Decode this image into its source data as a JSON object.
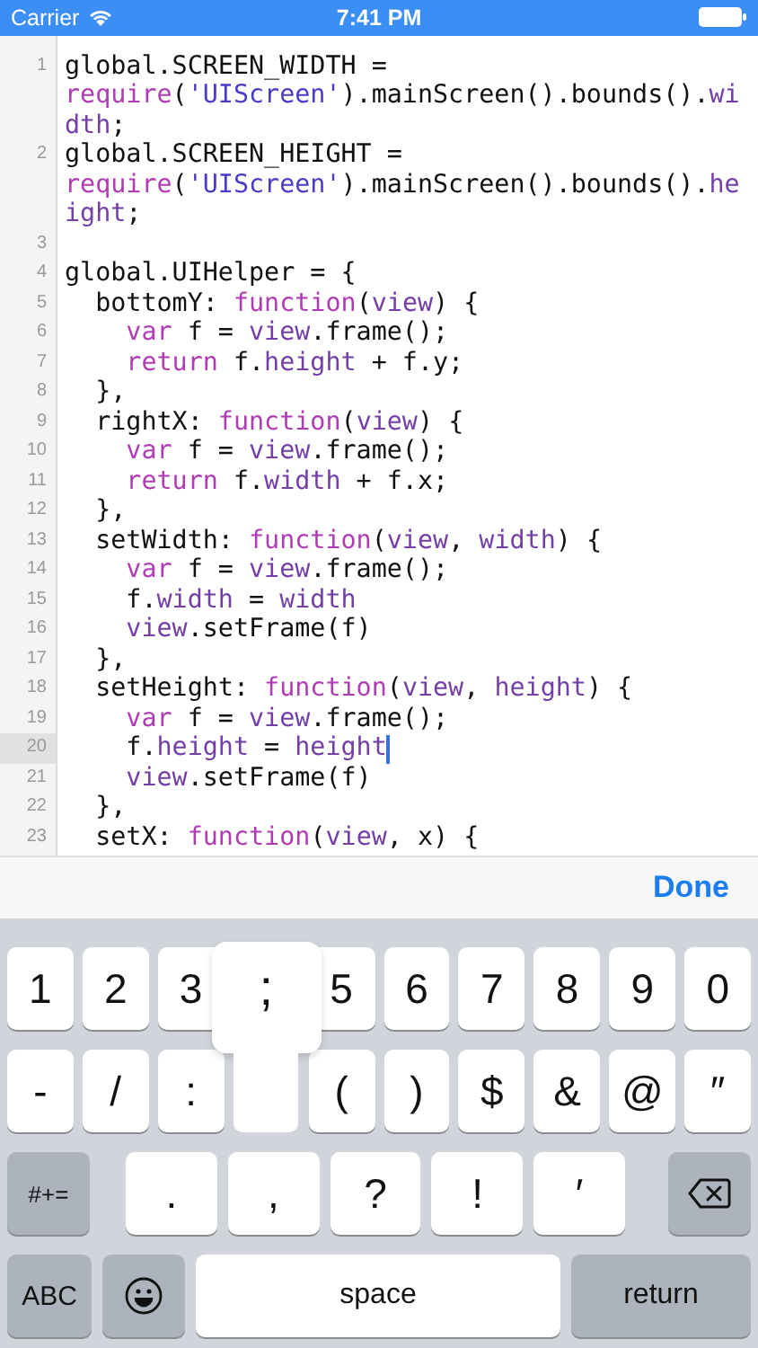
{
  "status_bar": {
    "carrier": "Carrier",
    "time": "7:41 PM"
  },
  "editor": {
    "lines": [
      {
        "number": "1",
        "current": false,
        "rows": [
          {
            "segments": [
              {
                "kind": "plain",
                "text": "global.SCREEN_WIDTH ="
              }
            ]
          },
          {
            "segments": [
              {
                "kind": "keyword",
                "text": "require"
              },
              {
                "kind": "plain",
                "text": "("
              },
              {
                "kind": "string",
                "text": "'UIScreen'"
              },
              {
                "kind": "plain",
                "text": ").mainScreen().bounds()."
              },
              {
                "kind": "ident",
                "text": "wi"
              }
            ]
          },
          {
            "segments": [
              {
                "kind": "ident",
                "text": "dth"
              },
              {
                "kind": "plain",
                "text": ";"
              }
            ]
          }
        ]
      },
      {
        "number": "2",
        "current": false,
        "rows": [
          {
            "segments": [
              {
                "kind": "plain",
                "text": "global.SCREEN_HEIGHT ="
              }
            ]
          },
          {
            "segments": [
              {
                "kind": "keyword",
                "text": "require"
              },
              {
                "kind": "plain",
                "text": "("
              },
              {
                "kind": "string",
                "text": "'UIScreen'"
              },
              {
                "kind": "plain",
                "text": ").mainScreen().bounds()."
              },
              {
                "kind": "ident",
                "text": "he"
              }
            ]
          },
          {
            "segments": [
              {
                "kind": "ident",
                "text": "ight"
              },
              {
                "kind": "plain",
                "text": ";"
              }
            ]
          }
        ]
      },
      {
        "number": "3",
        "current": false
      },
      {
        "number": "4",
        "current": false,
        "rows": [
          {
            "segments": [
              {
                "kind": "plain",
                "text": "global.UIHelper = {"
              }
            ]
          }
        ]
      },
      {
        "number": "5",
        "current": false,
        "rows": [
          {
            "segments": [
              {
                "kind": "plain",
                "text": "  bottomY: "
              },
              {
                "kind": "keyword",
                "text": "function"
              },
              {
                "kind": "plain",
                "text": "("
              },
              {
                "kind": "ident",
                "text": "view"
              },
              {
                "kind": "plain",
                "text": ") {"
              }
            ]
          }
        ]
      },
      {
        "number": "6",
        "current": false,
        "rows": [
          {
            "segments": [
              {
                "kind": "keyword",
                "text": "    var"
              },
              {
                "kind": "plain",
                "text": " f = "
              },
              {
                "kind": "ident",
                "text": "view"
              },
              {
                "kind": "plain",
                "text": ".frame();"
              }
            ]
          }
        ]
      },
      {
        "number": "7",
        "current": false,
        "rows": [
          {
            "segments": [
              {
                "kind": "keyword",
                "text": "    return"
              },
              {
                "kind": "plain",
                "text": " f."
              },
              {
                "kind": "ident",
                "text": "height"
              },
              {
                "kind": "plain",
                "text": " + f.y;"
              }
            ]
          }
        ]
      },
      {
        "number": "8",
        "current": false,
        "rows": [
          {
            "segments": [
              {
                "kind": "plain",
                "text": "  },"
              }
            ]
          }
        ]
      },
      {
        "number": "9",
        "current": false,
        "rows": [
          {
            "segments": [
              {
                "kind": "plain",
                "text": "  rightX: "
              },
              {
                "kind": "keyword",
                "text": "function"
              },
              {
                "kind": "plain",
                "text": "("
              },
              {
                "kind": "ident",
                "text": "view"
              },
              {
                "kind": "plain",
                "text": ") {"
              }
            ]
          }
        ]
      },
      {
        "number": "10",
        "current": false,
        "rows": [
          {
            "segments": [
              {
                "kind": "keyword",
                "text": "    var"
              },
              {
                "kind": "plain",
                "text": " f = "
              },
              {
                "kind": "ident",
                "text": "view"
              },
              {
                "kind": "plain",
                "text": ".frame();"
              }
            ]
          }
        ]
      },
      {
        "number": "11",
        "current": false,
        "rows": [
          {
            "segments": [
              {
                "kind": "keyword",
                "text": "    return"
              },
              {
                "kind": "plain",
                "text": " f."
              },
              {
                "kind": "ident",
                "text": "width"
              },
              {
                "kind": "plain",
                "text": " + f.x;"
              }
            ]
          }
        ]
      },
      {
        "number": "12",
        "current": false,
        "rows": [
          {
            "segments": [
              {
                "kind": "plain",
                "text": "  },"
              }
            ]
          }
        ]
      },
      {
        "number": "13",
        "current": false,
        "rows": [
          {
            "segments": [
              {
                "kind": "plain",
                "text": "  setWidth: "
              },
              {
                "kind": "keyword",
                "text": "function"
              },
              {
                "kind": "plain",
                "text": "("
              },
              {
                "kind": "ident",
                "text": "view"
              },
              {
                "kind": "plain",
                "text": ", "
              },
              {
                "kind": "ident",
                "text": "width"
              },
              {
                "kind": "plain",
                "text": ") {"
              }
            ]
          }
        ]
      },
      {
        "number": "14",
        "current": false,
        "rows": [
          {
            "segments": [
              {
                "kind": "keyword",
                "text": "    var"
              },
              {
                "kind": "plain",
                "text": " f = "
              },
              {
                "kind": "ident",
                "text": "view"
              },
              {
                "kind": "plain",
                "text": ".frame();"
              }
            ]
          }
        ]
      },
      {
        "number": "15",
        "current": false,
        "rows": [
          {
            "segments": [
              {
                "kind": "plain",
                "text": "    f."
              },
              {
                "kind": "ident",
                "text": "width"
              },
              {
                "kind": "plain",
                "text": " = "
              },
              {
                "kind": "ident",
                "text": "width"
              }
            ]
          }
        ]
      },
      {
        "number": "16",
        "current": false,
        "rows": [
          {
            "segments": [
              {
                "kind": "ident",
                "text": "    view"
              },
              {
                "kind": "plain",
                "text": ".setFrame(f)"
              }
            ]
          }
        ]
      },
      {
        "number": "17",
        "current": false,
        "rows": [
          {
            "segments": [
              {
                "kind": "plain",
                "text": "  },"
              }
            ]
          }
        ]
      },
      {
        "number": "18",
        "current": false,
        "rows": [
          {
            "segments": [
              {
                "kind": "plain",
                "text": "  setHeight: "
              },
              {
                "kind": "keyword",
                "text": "function"
              },
              {
                "kind": "plain",
                "text": "("
              },
              {
                "kind": "ident",
                "text": "view"
              },
              {
                "kind": "plain",
                "text": ", "
              },
              {
                "kind": "ident",
                "text": "height"
              },
              {
                "kind": "plain",
                "text": ") {"
              }
            ]
          }
        ]
      },
      {
        "number": "19",
        "current": false,
        "rows": [
          {
            "segments": [
              {
                "kind": "keyword",
                "text": "    var"
              },
              {
                "kind": "plain",
                "text": " f = "
              },
              {
                "kind": "ident",
                "text": "view"
              },
              {
                "kind": "plain",
                "text": ".frame();"
              }
            ]
          }
        ]
      },
      {
        "number": "20",
        "current": true,
        "rows": [
          {
            "segments": [
              {
                "kind": "plain",
                "text": "    f."
              },
              {
                "kind": "ident",
                "text": "height"
              },
              {
                "kind": "plain",
                "text": " = "
              },
              {
                "kind": "ident",
                "text": "height"
              }
            ]
          }
        ]
      },
      {
        "number": "21",
        "current": false,
        "rows": [
          {
            "segments": [
              {
                "kind": "ident",
                "text": "    view"
              },
              {
                "kind": "plain",
                "text": ".setFrame(f)"
              }
            ]
          }
        ]
      },
      {
        "number": "22",
        "current": false,
        "rows": [
          {
            "segments": [
              {
                "kind": "plain",
                "text": "  },"
              }
            ]
          }
        ]
      },
      {
        "number": "23",
        "current": false,
        "rows": [
          {
            "segments": [
              {
                "kind": "plain",
                "text": "  setX: "
              },
              {
                "kind": "keyword",
                "text": "function"
              },
              {
                "kind": "plain",
                "text": "("
              },
              {
                "kind": "ident",
                "text": "view"
              },
              {
                "kind": "plain",
                "text": ", x) {"
              }
            ]
          }
        ]
      }
    ]
  },
  "toolbar": {
    "done": "Done"
  },
  "keyboard": {
    "rows": [
      {
        "keys": [
          {
            "kind": "char",
            "label": "1"
          },
          {
            "kind": "char",
            "label": "2"
          },
          {
            "kind": "char",
            "label": "3"
          },
          {
            "kind": "covered"
          },
          {
            "kind": "char",
            "label": "5"
          },
          {
            "kind": "char",
            "label": "6"
          },
          {
            "kind": "char",
            "label": "7"
          },
          {
            "kind": "char",
            "label": "8"
          },
          {
            "kind": "char",
            "label": "9"
          },
          {
            "kind": "char",
            "label": "0"
          }
        ]
      },
      {
        "keys": [
          {
            "kind": "char",
            "label": "-"
          },
          {
            "kind": "char",
            "label": "/"
          },
          {
            "kind": "char",
            "label": ":"
          },
          {
            "kind": "pressed",
            "label": ";"
          },
          {
            "kind": "char",
            "label": "("
          },
          {
            "kind": "char",
            "label": ")"
          },
          {
            "kind": "char",
            "label": "$"
          },
          {
            "kind": "char",
            "label": "&"
          },
          {
            "kind": "char",
            "label": "@"
          },
          {
            "kind": "char",
            "label": "″"
          }
        ]
      },
      {
        "keys": [
          {
            "kind": "function",
            "label": "#+="
          },
          {
            "kind": "wide",
            "label": "."
          },
          {
            "kind": "wide",
            "label": ","
          },
          {
            "kind": "wide",
            "label": "?"
          },
          {
            "kind": "wide",
            "label": "!"
          },
          {
            "kind": "wide",
            "label": "′"
          },
          {
            "kind": "delete"
          }
        ]
      },
      {
        "keys": [
          {
            "kind": "function",
            "label": "ABC"
          },
          {
            "kind": "emoji"
          },
          {
            "kind": "space",
            "label": "space"
          },
          {
            "kind": "return",
            "label": "return"
          }
        ]
      }
    ]
  }
}
